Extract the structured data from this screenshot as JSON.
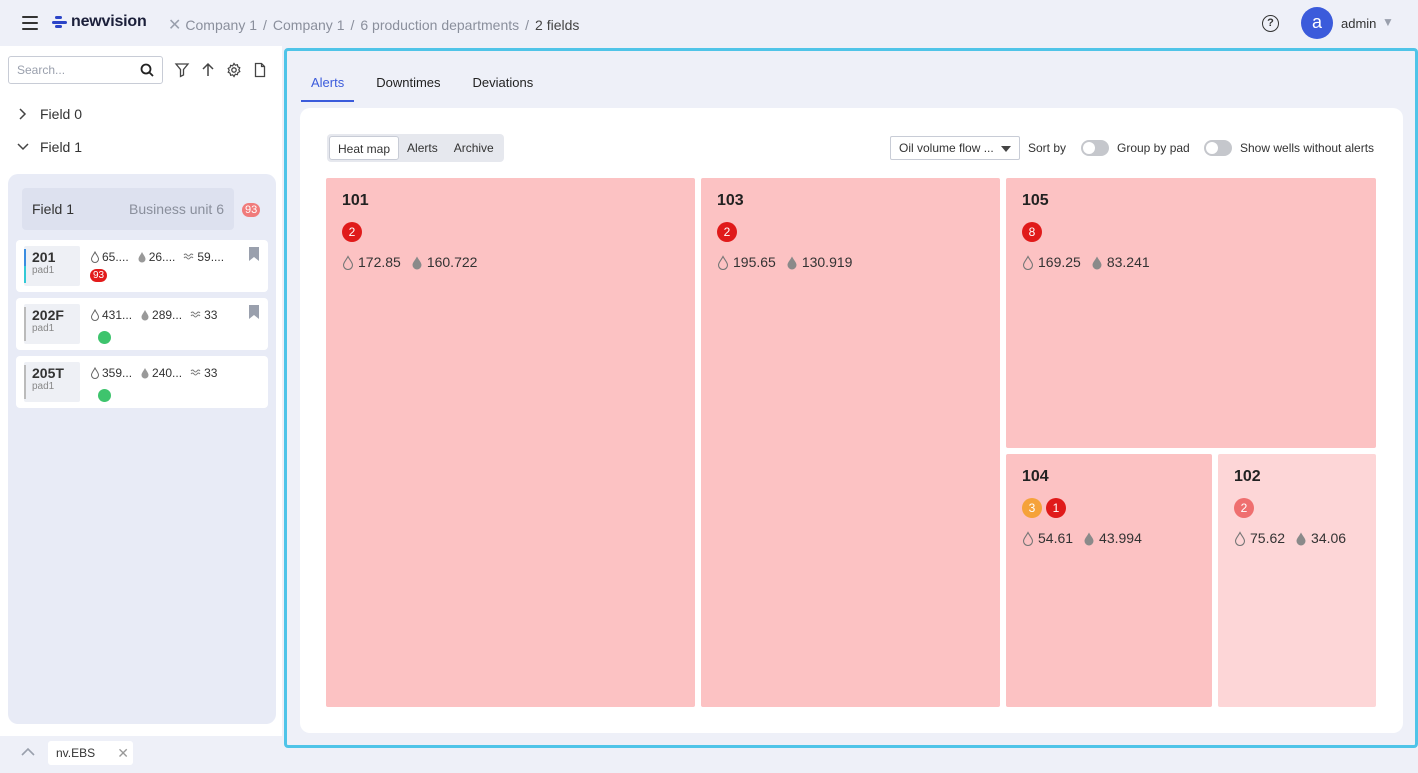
{
  "header": {
    "logo": "newvision",
    "breadcrumb": [
      "Company 1",
      "Company 1",
      "6 production departments"
    ],
    "breadcrumb_current": "2 fields",
    "avatar_letter": "a",
    "username": "admin"
  },
  "sidebar": {
    "search_placeholder": "Search...",
    "tree": [
      {
        "label": "Field 0",
        "chevron": ">"
      },
      {
        "label": "Field 1",
        "chevron": "v"
      }
    ],
    "field_header": {
      "name": "Field 1",
      "unit": "Business unit 6",
      "badge": "93"
    },
    "wells": [
      {
        "id": "201",
        "pad": "pad1",
        "m1": "65....",
        "m2": "26....",
        "m3": "59....",
        "alert": "93",
        "bar_color": "#3b8de0"
      },
      {
        "id": "202F",
        "pad": "pad1",
        "m1": "431...",
        "m2": "289...",
        "m3": "33",
        "alert": "",
        "bar_color": "#bbbbbb"
      },
      {
        "id": "205T",
        "pad": "pad1",
        "m1": "359...",
        "m2": "240...",
        "m3": "33",
        "alert": "",
        "bar_color": "#bbbbbb"
      }
    ],
    "bottom_tab": "nv.EBS"
  },
  "main": {
    "tabs": [
      "Alerts",
      "Downtimes",
      "Deviations"
    ],
    "view_modes": [
      "Heat map",
      "Alerts",
      "Archive"
    ],
    "metric_select": "Oil volume flow ...",
    "sort_label": "Sort by",
    "group_label": "Group by pad",
    "show_label": "Show wells without alerts"
  },
  "tiles": [
    {
      "name": "101",
      "badges": [
        {
          "n": "2",
          "c": "red"
        }
      ],
      "v1": "172.85",
      "v2": "160.722",
      "color": "#fcc2c3"
    },
    {
      "name": "103",
      "badges": [
        {
          "n": "2",
          "c": "red"
        }
      ],
      "v1": "195.65",
      "v2": "130.919",
      "color": "#fcc2c3"
    },
    {
      "name": "105",
      "badges": [
        {
          "n": "8",
          "c": "red"
        }
      ],
      "v1": "169.25",
      "v2": "83.241",
      "color": "#fcc2c3"
    },
    {
      "name": "104",
      "badges": [
        {
          "n": "3",
          "c": "orange"
        },
        {
          "n": "1",
          "c": "red"
        }
      ],
      "v1": "54.61",
      "v2": "43.994",
      "color": "#fcc2c3"
    },
    {
      "name": "102",
      "badges": [
        {
          "n": "2",
          "c": "pink"
        }
      ],
      "v1": "75.62",
      "v2": "34.06",
      "color": "#fdd6d7"
    }
  ]
}
